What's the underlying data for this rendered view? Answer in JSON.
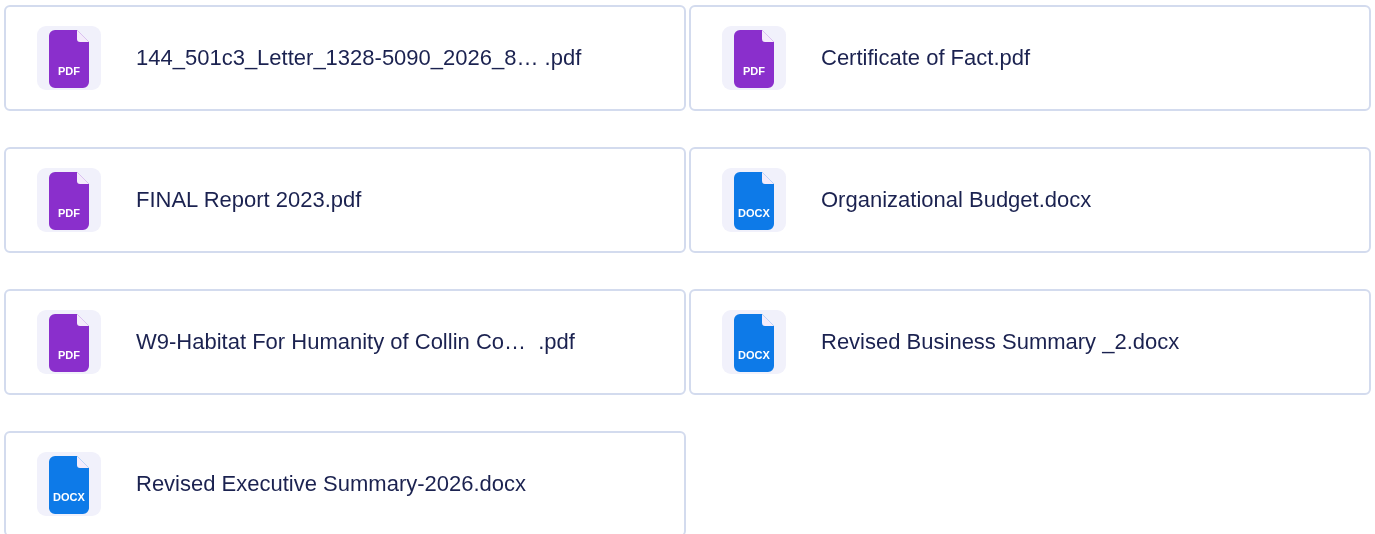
{
  "files": [
    {
      "name": "144_501c3_Letter_1328-5090_2026_8… .pdf",
      "kind": "pdf",
      "badge": "PDF"
    },
    {
      "name": "Certificate of Fact.pdf",
      "kind": "pdf",
      "badge": "PDF"
    },
    {
      "name": "FINAL Report 2023.pdf",
      "kind": "pdf",
      "badge": "PDF"
    },
    {
      "name": "Organizational Budget.docx",
      "kind": "docx",
      "badge": "DOCX"
    },
    {
      "name": "W9-Habitat For Humanity of Collin Co…  .pdf",
      "kind": "pdf",
      "badge": "PDF"
    },
    {
      "name": "Revised Business Summary _2.docx",
      "kind": "docx",
      "badge": "DOCX"
    },
    {
      "name": "Revised Executive Summary-2026.docx",
      "kind": "docx",
      "badge": "DOCX"
    }
  ]
}
